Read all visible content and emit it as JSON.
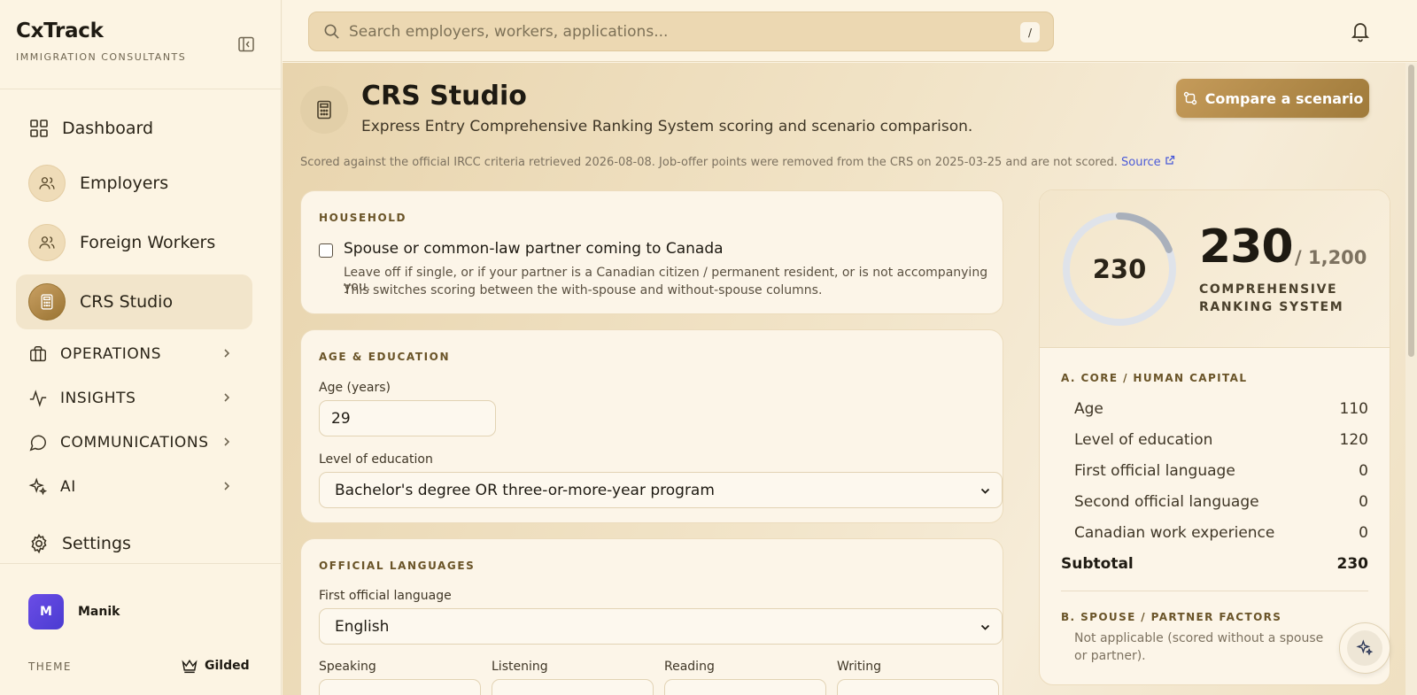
{
  "brand": {
    "name": "CxTrack",
    "subtitle": "IMMIGRATION CONSULTANTS"
  },
  "sidebar": {
    "items": [
      {
        "label": "Dashboard",
        "icon": "grid-icon"
      },
      {
        "label": "Employers",
        "icon": "users-icon"
      },
      {
        "label": "Foreign Workers",
        "icon": "users-icon"
      },
      {
        "label": "CRS Studio",
        "icon": "calculator-icon",
        "active": true
      }
    ],
    "groups": [
      {
        "label": "OPERATIONS",
        "icon": "briefcase-icon"
      },
      {
        "label": "INSIGHTS",
        "icon": "activity-icon"
      },
      {
        "label": "COMMUNICATIONS",
        "icon": "chat-icon"
      },
      {
        "label": "AI",
        "icon": "sparkles-icon"
      }
    ],
    "settings": {
      "label": "Settings",
      "icon": "gear-icon"
    },
    "user": {
      "initial": "M",
      "name": "Manik"
    },
    "theme": {
      "label": "THEME",
      "value": "Gilded",
      "icon": "crown-icon"
    }
  },
  "search": {
    "placeholder": "Search employers, workers, applications...",
    "shortcut": "/"
  },
  "page": {
    "title": "CRS Studio",
    "subtitle": "Express Entry Comprehensive Ranking System scoring and scenario comparison.",
    "compare_label": "Compare a scenario",
    "criteria_text": "Scored against the official IRCC criteria retrieved 2026-08-08. Job-offer points were removed from the CRS on 2025-03-25 and are not scored.",
    "source_label": "Source"
  },
  "household": {
    "heading": "HOUSEHOLD",
    "checkbox_label": "Spouse or common-law partner coming to Canada",
    "checked": false,
    "help_line1": "Leave off if single, or if your partner is a Canadian citizen / permanent resident, or is not accompanying you.",
    "help_line2": "This switches scoring between the with-spouse and without-spouse columns."
  },
  "age_education": {
    "heading": "AGE & EDUCATION",
    "age_label": "Age (years)",
    "age_value": "29",
    "education_label": "Level of education",
    "education_value": "Bachelor's degree OR three-or-more-year program"
  },
  "languages": {
    "heading": "OFFICIAL LANGUAGES",
    "first_label": "First official language",
    "first_value": "English",
    "abilities": [
      "Speaking",
      "Listening",
      "Reading",
      "Writing"
    ]
  },
  "score": {
    "value": "230",
    "max": "/ 1,200",
    "progress": 0.19,
    "label_line1": "COMPREHENSIVE",
    "label_line2": "RANKING SYSTEM",
    "core_heading": "A. CORE / HUMAN CAPITAL",
    "core_rows": [
      {
        "label": "Age",
        "value": "110"
      },
      {
        "label": "Level of education",
        "value": "120"
      },
      {
        "label": "First official language",
        "value": "0"
      },
      {
        "label": "Second official language",
        "value": "0"
      },
      {
        "label": "Canadian work experience",
        "value": "0"
      }
    ],
    "subtotal_label": "Subtotal",
    "subtotal_value": "230",
    "spouse_heading": "B. SPOUSE / PARTNER FACTORS",
    "spouse_note": "Not applicable (scored without a spouse or partner)."
  },
  "colors": {
    "accent": "#b38a4a",
    "ring_track": "#dfe3ea",
    "ring_fill": "#a9b0bb",
    "link": "#4b5bd8"
  }
}
